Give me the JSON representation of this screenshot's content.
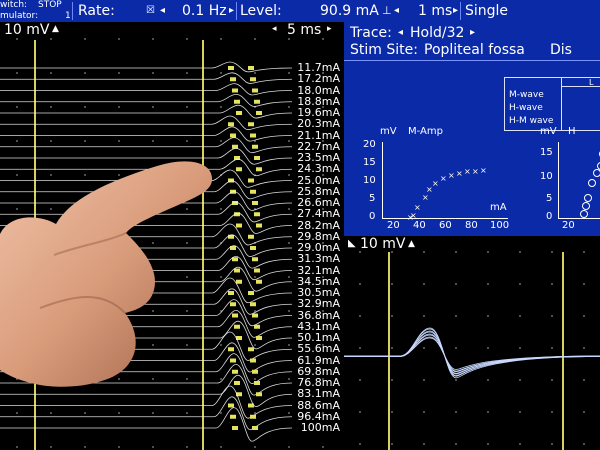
{
  "top_bar": {
    "switch_label": "witch:",
    "switch_value": "STOP",
    "stimulator_label": "mulator:",
    "stimulator_value": "1",
    "rate_label": "Rate:",
    "rate_value": "0.1 Hz",
    "level_label": "Level:",
    "level_value": "90.9 mA",
    "pulse_value": "1 ms",
    "mode_value": "Single"
  },
  "left_panel": {
    "scale_label": "10 mV",
    "time_label": "5 ms",
    "current_labels": [
      "11.7mA",
      "17.2mA",
      "18.0mA",
      "18.8mA",
      "19.6mA",
      "20.3mA",
      "21.1mA",
      "22.7mA",
      "23.5mA",
      "24.3mA",
      "25.0mA",
      "25.8mA",
      "26.6mA",
      "27.4mA",
      "28.2mA",
      "29.8mA",
      "29.0mA",
      "31.3mA",
      "32.1mA",
      "34.5mA",
      "30.5mA",
      "32.9mA",
      "36.8mA",
      "43.1mA",
      "50.1mA",
      "55.6mA",
      "61.9mA",
      "69.8mA",
      "76.8mA",
      "83.1mA",
      "88.6mA",
      "96.4mA",
      "100mA"
    ]
  },
  "right_top": {
    "trace_label": "Trace:",
    "trace_value": "Hold/32",
    "stim_site_label": "Stim Site:",
    "stim_site_value": "Popliteal fossa",
    "cutoff_text": "Dis",
    "table_rows": [
      "M-wave",
      "H-wave",
      "H-M wave"
    ],
    "table_header_cutoff": "L",
    "plot1": {
      "title_left": "mV",
      "title_right": "M-Amp",
      "x_label": "mA",
      "y_ticks": [
        "20",
        "15",
        "10",
        "5",
        "0"
      ],
      "x_ticks": [
        "20",
        "40",
        "60",
        "80",
        "100"
      ]
    },
    "plot2": {
      "title_left": "mV",
      "title_right": "H",
      "y_ticks": [
        "15",
        "10",
        "5",
        "0"
      ],
      "x_ticks": [
        "20"
      ]
    }
  },
  "right_bottom": {
    "scale_label": "10 mV"
  }
}
